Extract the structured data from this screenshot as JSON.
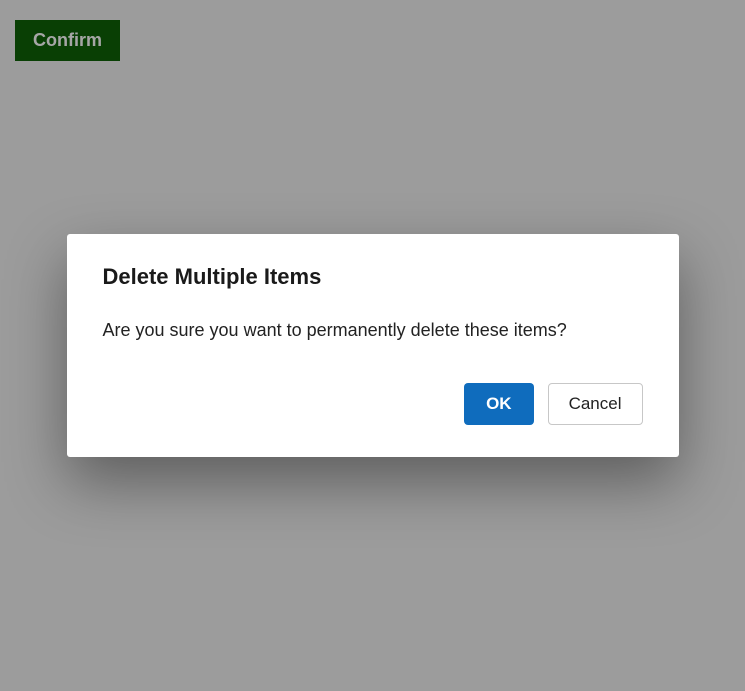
{
  "page": {
    "confirm_button_label": "Confirm"
  },
  "dialog": {
    "title": "Delete Multiple Items",
    "message": "Are you sure you want to permanently delete these items?",
    "ok_label": "OK",
    "cancel_label": "Cancel"
  }
}
